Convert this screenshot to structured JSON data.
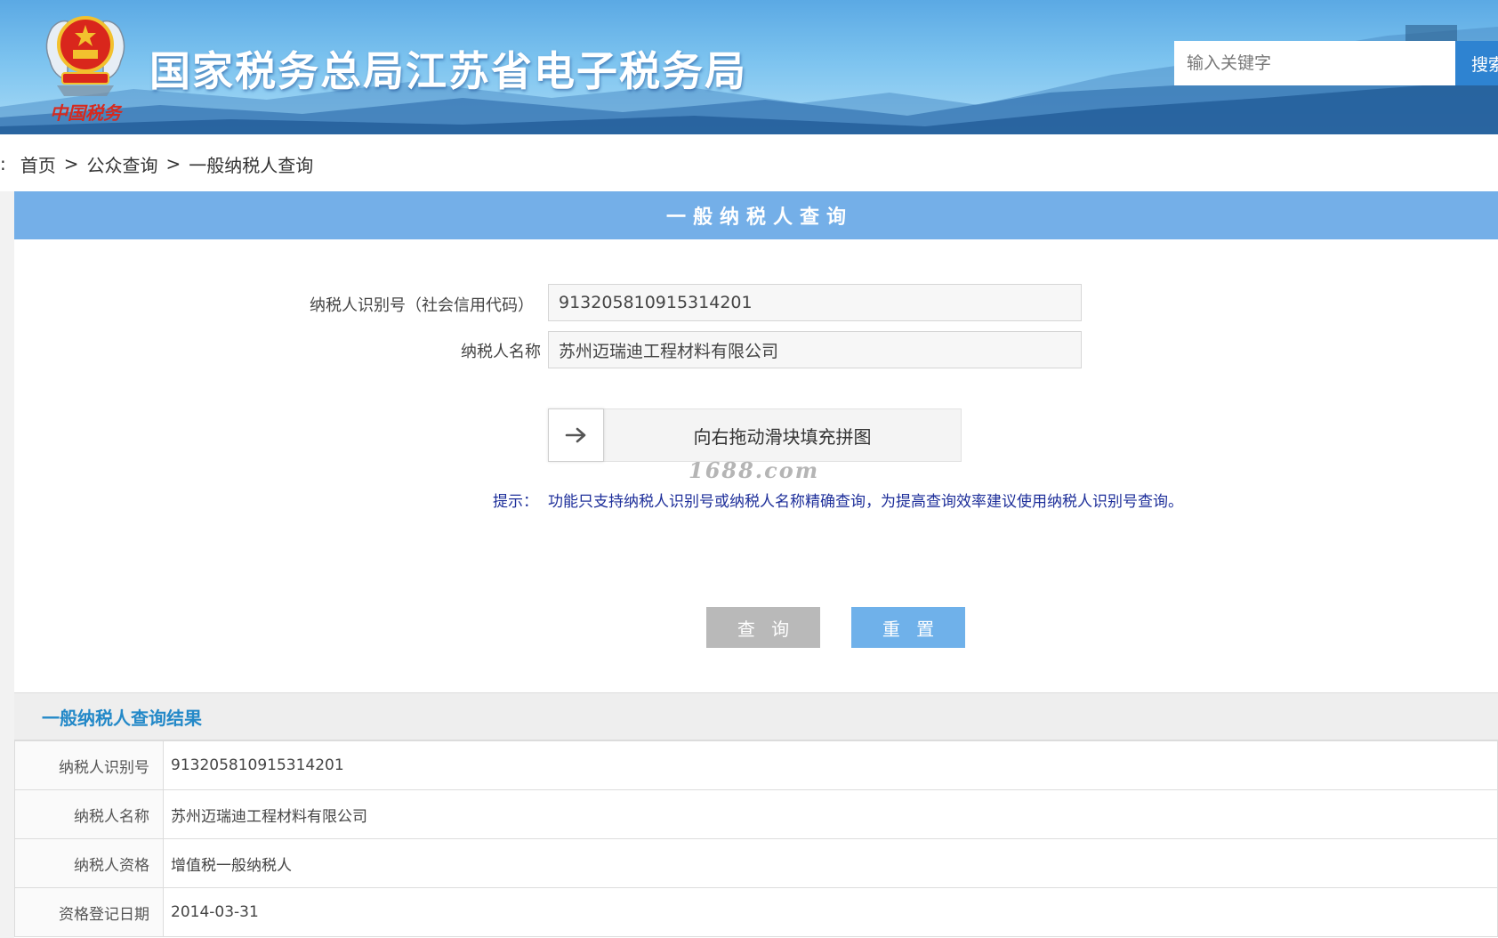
{
  "header": {
    "site_title": "国家税务总局江苏省电子税务局",
    "logo_caption": "中国税务",
    "search": {
      "placeholder": "输入关键字",
      "button_label": "搜索"
    }
  },
  "breadcrumb": {
    "lead": ":",
    "items": [
      "首页",
      "公众查询",
      "一般纳税人查询"
    ],
    "separator": ">"
  },
  "query_panel": {
    "title": "一般纳税人查询",
    "fields": [
      {
        "label": "纳税人识别号（社会信用代码）",
        "value": "913205810915314201"
      },
      {
        "label": "纳税人名称",
        "value": "苏州迈瑞迪工程材料有限公司"
      }
    ],
    "slider": {
      "handle_icon": "arrow-right-icon",
      "text": "向右拖动滑块填充拼图"
    },
    "watermark": "1688.com",
    "tip_label": "提示：",
    "tip_text": "功能只支持纳税人识别号或纳税人名称精确查询，为提高查询效率建议使用纳税人识别号查询。",
    "buttons": {
      "query_label": "查 询",
      "reset_label": "重 置"
    }
  },
  "results": {
    "title": "一般纳税人查询结果",
    "rows": [
      {
        "label": "纳税人识别号",
        "value": "913205810915314201"
      },
      {
        "label": "纳税人名称",
        "value": "苏州迈瑞迪工程材料有限公司"
      },
      {
        "label": "纳税人资格",
        "value": "增值税一般纳税人"
      },
      {
        "label": "资格登记日期",
        "value": "2014-03-31"
      }
    ]
  },
  "colors": {
    "panel_header": "#74afe8",
    "query_button": "#b9b9b9",
    "reset_button": "#6fb1ea",
    "results_title": "#2489c8",
    "tip_text": "#1e2f9a"
  }
}
